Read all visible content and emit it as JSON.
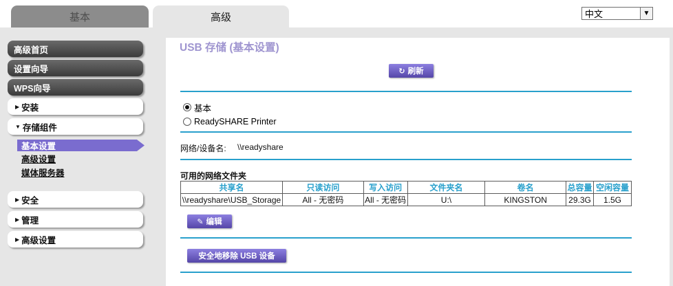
{
  "tabs": {
    "basic": "基本",
    "advanced": "高级"
  },
  "language": {
    "selected": "中文"
  },
  "sidebar": {
    "home": "高级首页",
    "wizard": "设置向导",
    "wps": "WPS向导",
    "setup": "安装",
    "storage": "存储组件",
    "storage_sub": {
      "basic": "基本设置",
      "advanced": "高级设置",
      "media": "媒体服务器"
    },
    "security": "安全",
    "admin": "管理",
    "advanced_setup": "高级设置"
  },
  "main": {
    "title": "USB 存储 (基本设置)",
    "refresh": "刷新",
    "radio_basic": "基本",
    "radio_printer": "ReadySHARE Printer",
    "network_label": "网络/设备名:",
    "network_value": "\\\\readyshare",
    "folders_label": "可用的网络文件夹",
    "edit": "编辑",
    "remove": "安全地移除 USB 设备"
  },
  "table": {
    "headers": [
      "共享名",
      "只读访问",
      "写入访问",
      "文件夹名",
      "卷名",
      "总容量",
      "空闲容量"
    ],
    "rows": [
      [
        "\\\\readyshare\\USB_Storage",
        "All - 无密码",
        "All - 无密码",
        "U:\\",
        "KINGSTON",
        "29.3G",
        "1.5G"
      ]
    ]
  },
  "colors": {
    "accent": "#28a0cc",
    "button": "#6a5cc2",
    "title": "#9f95d0",
    "selected_nav": "#7a6ccf"
  },
  "icons": {
    "refresh": "refresh-icon",
    "edit": "pencil-icon",
    "dropdown": "chevron-down-icon"
  }
}
